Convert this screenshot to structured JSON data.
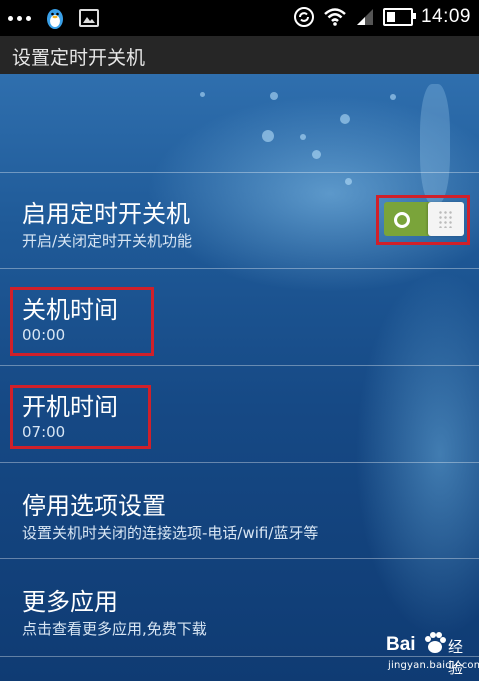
{
  "status_bar": {
    "time": "14:09"
  },
  "titlebar": {
    "title": "设置定时开关机"
  },
  "settings": [
    {
      "label": "启用定时开关机",
      "sub": "开启/关闭定时开关机功能",
      "toggle": true
    },
    {
      "label": "关机时间",
      "sub": "00:00"
    },
    {
      "label": "开机时间",
      "sub": "07:00"
    },
    {
      "label": "停用选项设置",
      "sub": "设置关机时关闭的连接选项-电话/wifi/蓝牙等"
    },
    {
      "label": "更多应用",
      "sub": "点击查看更多应用,免费下载"
    }
  ],
  "colors": {
    "toggle_on": "#7aa43a",
    "highlight": "#d0202a"
  },
  "watermark": {
    "brand": "Bai",
    "brand_cn": "经验",
    "url": "jingyan.baidu.com"
  }
}
